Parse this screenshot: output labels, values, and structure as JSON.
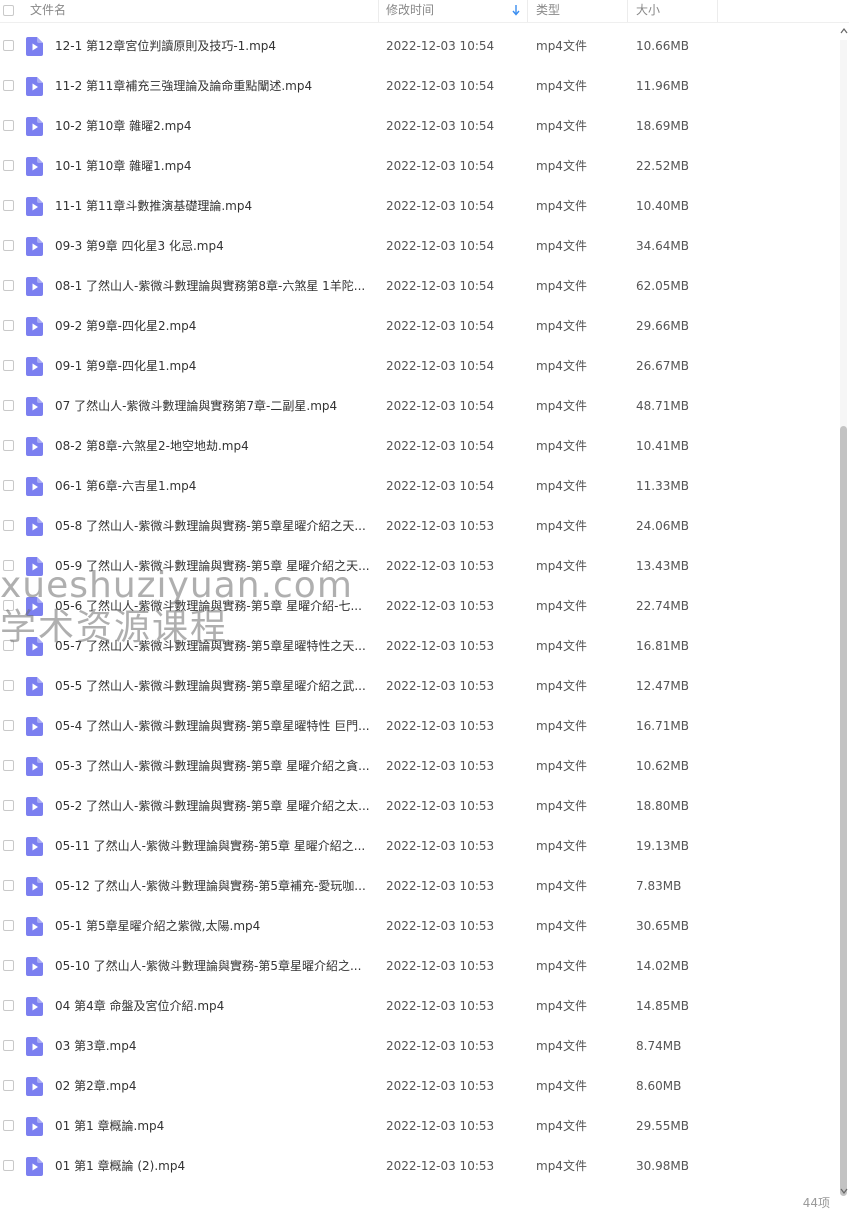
{
  "columns": {
    "name": "文件名",
    "modified": "修改时间",
    "type": "类型",
    "size": "大小"
  },
  "files": [
    {
      "name": "12-1 第12章宮位判讀原則及技巧-1.mp4",
      "date": "2022-12-03 10:54",
      "type": "mp4文件",
      "size": "10.66MB"
    },
    {
      "name": "11-2 第11章補充三強理論及論命重點闡述.mp4",
      "date": "2022-12-03 10:54",
      "type": "mp4文件",
      "size": "11.96MB"
    },
    {
      "name": "10-2 第10章 雜曜2.mp4",
      "date": "2022-12-03 10:54",
      "type": "mp4文件",
      "size": "18.69MB"
    },
    {
      "name": "10-1 第10章 雜曜1.mp4",
      "date": "2022-12-03 10:54",
      "type": "mp4文件",
      "size": "22.52MB"
    },
    {
      "name": "11-1 第11章斗數推演基礎理論.mp4",
      "date": "2022-12-03 10:54",
      "type": "mp4文件",
      "size": "10.40MB"
    },
    {
      "name": "09-3 第9章 四化星3 化忌.mp4",
      "date": "2022-12-03 10:54",
      "type": "mp4文件",
      "size": "34.64MB"
    },
    {
      "name": "08-1 了然山人-紫微斗數理論與實務第8章-六煞星 1羊陀...",
      "date": "2022-12-03 10:54",
      "type": "mp4文件",
      "size": "62.05MB"
    },
    {
      "name": "09-2 第9章-四化星2.mp4",
      "date": "2022-12-03 10:54",
      "type": "mp4文件",
      "size": "29.66MB"
    },
    {
      "name": "09-1 第9章-四化星1.mp4",
      "date": "2022-12-03 10:54",
      "type": "mp4文件",
      "size": "26.67MB"
    },
    {
      "name": "07 了然山人-紫微斗數理論與實務第7章-二副星.mp4",
      "date": "2022-12-03 10:54",
      "type": "mp4文件",
      "size": "48.71MB"
    },
    {
      "name": "08-2 第8章-六煞星2-地空地劫.mp4",
      "date": "2022-12-03 10:54",
      "type": "mp4文件",
      "size": "10.41MB"
    },
    {
      "name": "06-1 第6章-六吉星1.mp4",
      "date": "2022-12-03 10:54",
      "type": "mp4文件",
      "size": "11.33MB"
    },
    {
      "name": "05-8 了然山人-紫微斗數理論與實務-第5章星曜介紹之天...",
      "date": "2022-12-03 10:53",
      "type": "mp4文件",
      "size": "24.06MB"
    },
    {
      "name": "05-9 了然山人-紫微斗數理論與實務-第5章 星曜介紹之天...",
      "date": "2022-12-03 10:53",
      "type": "mp4文件",
      "size": "13.43MB"
    },
    {
      "name": "05-6 了然山人-紫微斗數理論與實務-第5章 星曜介紹-七...",
      "date": "2022-12-03 10:53",
      "type": "mp4文件",
      "size": "22.74MB"
    },
    {
      "name": "05-7 了然山人-紫微斗數理論與實務-第5章星曜特性之天...",
      "date": "2022-12-03 10:53",
      "type": "mp4文件",
      "size": "16.81MB"
    },
    {
      "name": "05-5 了然山人-紫微斗數理論與實務-第5章星曜介紹之武...",
      "date": "2022-12-03 10:53",
      "type": "mp4文件",
      "size": "12.47MB"
    },
    {
      "name": "05-4 了然山人-紫微斗數理論與實務-第5章星曜特性 巨門...",
      "date": "2022-12-03 10:53",
      "type": "mp4文件",
      "size": "16.71MB"
    },
    {
      "name": "05-3 了然山人-紫微斗數理論與實務-第5章 星曜介紹之貪...",
      "date": "2022-12-03 10:53",
      "type": "mp4文件",
      "size": "10.62MB"
    },
    {
      "name": "05-2 了然山人-紫微斗數理論與實務-第5章 星曜介紹之太...",
      "date": "2022-12-03 10:53",
      "type": "mp4文件",
      "size": "18.80MB"
    },
    {
      "name": "05-11 了然山人-紫微斗數理論與實務-第5章 星曜介紹之...",
      "date": "2022-12-03 10:53",
      "type": "mp4文件",
      "size": "19.13MB"
    },
    {
      "name": "05-12 了然山人-紫微斗數理論與實務-第5章補充-愛玩咖...",
      "date": "2022-12-03 10:53",
      "type": "mp4文件",
      "size": "7.83MB"
    },
    {
      "name": "05-1 第5章星曜介紹之紫微,太陽.mp4",
      "date": "2022-12-03 10:53",
      "type": "mp4文件",
      "size": "30.65MB"
    },
    {
      "name": "05-10 了然山人-紫微斗數理論與實務-第5章星曜介紹之...",
      "date": "2022-12-03 10:53",
      "type": "mp4文件",
      "size": "14.02MB"
    },
    {
      "name": "04 第4章 命盤及宮位介紹.mp4",
      "date": "2022-12-03 10:53",
      "type": "mp4文件",
      "size": "14.85MB"
    },
    {
      "name": "03 第3章.mp4",
      "date": "2022-12-03 10:53",
      "type": "mp4文件",
      "size": "8.74MB"
    },
    {
      "name": "02 第2章.mp4",
      "date": "2022-12-03 10:53",
      "type": "mp4文件",
      "size": "8.60MB"
    },
    {
      "name": "01 第1 章概論.mp4",
      "date": "2022-12-03 10:53",
      "type": "mp4文件",
      "size": "29.55MB"
    },
    {
      "name": "01 第1 章概論 (2).mp4",
      "date": "2022-12-03 10:53",
      "type": "mp4文件",
      "size": "30.98MB"
    }
  ],
  "footer": {
    "count": "44项"
  },
  "watermark": {
    "line1": "xueshuziyuan.com",
    "line2": "学术资源课程"
  },
  "colors": {
    "video_icon": "#7b7ff0",
    "sort_arrow": "#3b8ef0",
    "scroll_thumb": "#c3c3c3"
  }
}
